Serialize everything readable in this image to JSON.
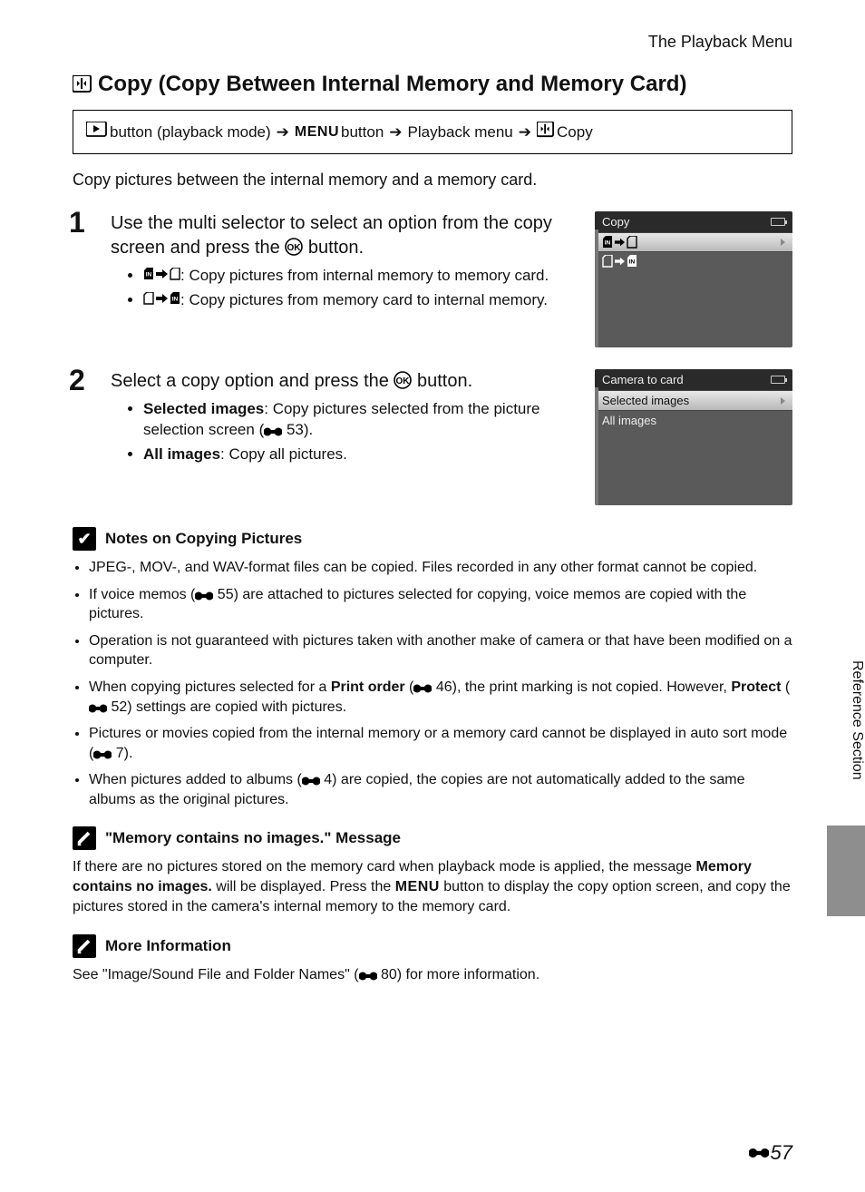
{
  "running_head": "The Playback Menu",
  "title": "Copy (Copy Between Internal Memory and Memory Card)",
  "navbox": {
    "t1": "button (playback mode)",
    "menu": "MENU",
    "t2": "button",
    "t3": "Playback menu",
    "t4": "Copy"
  },
  "intro": "Copy pictures between the internal memory and a memory card.",
  "step1": {
    "num": "1",
    "head_a": "Use the multi selector to select an option from the copy screen and press the ",
    "head_b": " button.",
    "b1": ": Copy pictures from internal memory to memory card.",
    "b2": ": Copy pictures from memory card to internal memory."
  },
  "screen1": {
    "title": "Copy"
  },
  "step2": {
    "num": "2",
    "head_a": "Select a copy option and press the ",
    "head_b": " button.",
    "b1_label": "Selected images",
    "b1_a": ": Copy pictures selected from the picture selection screen (",
    "b1_b": " 53).",
    "b2_label": "All images",
    "b2_text": ": Copy all pictures."
  },
  "screen2": {
    "title": "Camera to card",
    "row1": "Selected images",
    "row2": "All images"
  },
  "notes": {
    "title": "Notes on Copying Pictures",
    "n1": "JPEG-, MOV-, and WAV-format files can be copied. Files recorded in any other format cannot be copied.",
    "n2_a": "If voice memos (",
    "n2_b": " 55) are attached to pictures selected for copying, voice memos are copied with the pictures.",
    "n3": "Operation is not guaranteed with pictures taken with another make of camera or that have been modified on a computer.",
    "n4_a": "When copying pictures selected for a ",
    "n4_print": "Print order",
    "n4_b": " (",
    "n4_c": " 46), the print marking is not copied. However, ",
    "n4_protect": "Protect",
    "n4_d": " (",
    "n4_e": " 52) settings are copied with pictures.",
    "n5_a": "Pictures or movies copied from the internal memory or a memory card cannot be displayed in auto sort mode (",
    "n5_b": " 7).",
    "n6_a": "When pictures added to albums (",
    "n6_b": " 4) are copied, the copies are not automatically added to the same albums as the original pictures."
  },
  "msg": {
    "title": "\"Memory contains no images.\" Message",
    "body_a": "If there are no pictures stored on the memory card when playback mode is applied, the message ",
    "body_bold": "Memory contains no images.",
    "body_b": " will be displayed. Press the ",
    "body_c": " button to display the copy option screen, and copy the pictures stored in the camera's internal memory to the memory card."
  },
  "more": {
    "title": "More Information",
    "body_a": "See \"Image/Sound File and Folder Names\" (",
    "body_b": " 80) for more information."
  },
  "side_label": "Reference Section",
  "page_number": "57"
}
